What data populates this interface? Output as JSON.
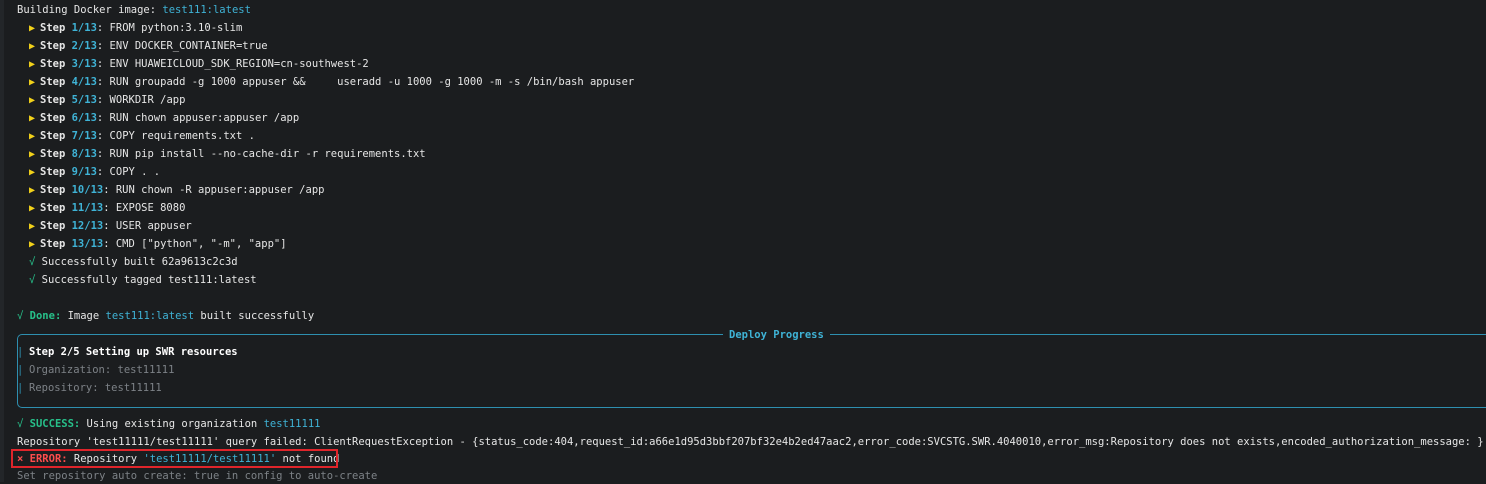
{
  "build": {
    "header_prefix": "Building Docker image: ",
    "header_image": "test111:latest",
    "steps": [
      {
        "word": "Step ",
        "num": "1/13",
        "cmd": ": FROM python:3.10-slim"
      },
      {
        "word": "Step ",
        "num": "2/13",
        "cmd": ": ENV DOCKER_CONTAINER=true"
      },
      {
        "word": "Step ",
        "num": "3/13",
        "cmd": ": ENV HUAWEICLOUD_SDK_REGION=cn-southwest-2"
      },
      {
        "word": "Step ",
        "num": "4/13",
        "cmd": ": RUN groupadd -g 1000 appuser &&     useradd -u 1000 -g 1000 -m -s /bin/bash appuser"
      },
      {
        "word": "Step ",
        "num": "5/13",
        "cmd": ": WORKDIR /app"
      },
      {
        "word": "Step ",
        "num": "6/13",
        "cmd": ": RUN chown appuser:appuser /app"
      },
      {
        "word": "Step ",
        "num": "7/13",
        "cmd": ": COPY requirements.txt ."
      },
      {
        "word": "Step ",
        "num": "8/13",
        "cmd": ": RUN pip install --no-cache-dir -r requirements.txt"
      },
      {
        "word": "Step ",
        "num": "9/13",
        "cmd": ": COPY . ."
      },
      {
        "word": "Step ",
        "num": "10/13",
        "cmd": ": RUN chown -R appuser:appuser /app"
      },
      {
        "word": "Step ",
        "num": "11/13",
        "cmd": ": EXPOSE 8080"
      },
      {
        "word": "Step ",
        "num": "12/13",
        "cmd": ": USER appuser"
      },
      {
        "word": "Step ",
        "num": "13/13",
        "cmd": ": CMD [\"python\", \"-m\", \"app\"]"
      }
    ],
    "built_line": "Successfully built 62a9613c2c3d",
    "tagged_line": "Successfully tagged test111:latest",
    "check_glyph": "√",
    "step_glyph": "▶"
  },
  "done": {
    "label": "Done:",
    "text_a": " Image ",
    "image": "test111:latest",
    "text_b": " built successfully"
  },
  "deploy": {
    "title": "Deploy Progress",
    "step_line": "Step 2/5 Setting up SWR resources",
    "org_line": "Organization: test11111",
    "repo_line": "Repository: test11111"
  },
  "success": {
    "label": "SUCCESS:",
    "text": " Using existing organization ",
    "org": "test11111"
  },
  "query_failed_line": "Repository 'test11111/test11111' query failed: ClientRequestException - {status_code:404,request_id:a66e1d95d3bbf207bf32e4b2ed47aac2,error_code:SVCSTG.SWR.4040010,error_msg:Repository does not exists,encoded_authorization_message: }",
  "error": {
    "glyph": "×",
    "label": "ERROR:",
    "text_a": " Repository ",
    "repo": "'test11111/test11111'",
    "text_b": " not found"
  },
  "hint_line": "Set repository auto create: true in config to auto-create",
  "colors": {
    "background": "#1b1d1f",
    "step_arrow": "#f2d21a",
    "accent_cyan": "#3fb3d6",
    "success_green": "#27c08a",
    "error_red": "#ff4d4d",
    "highlight_box": "#e0252b"
  }
}
